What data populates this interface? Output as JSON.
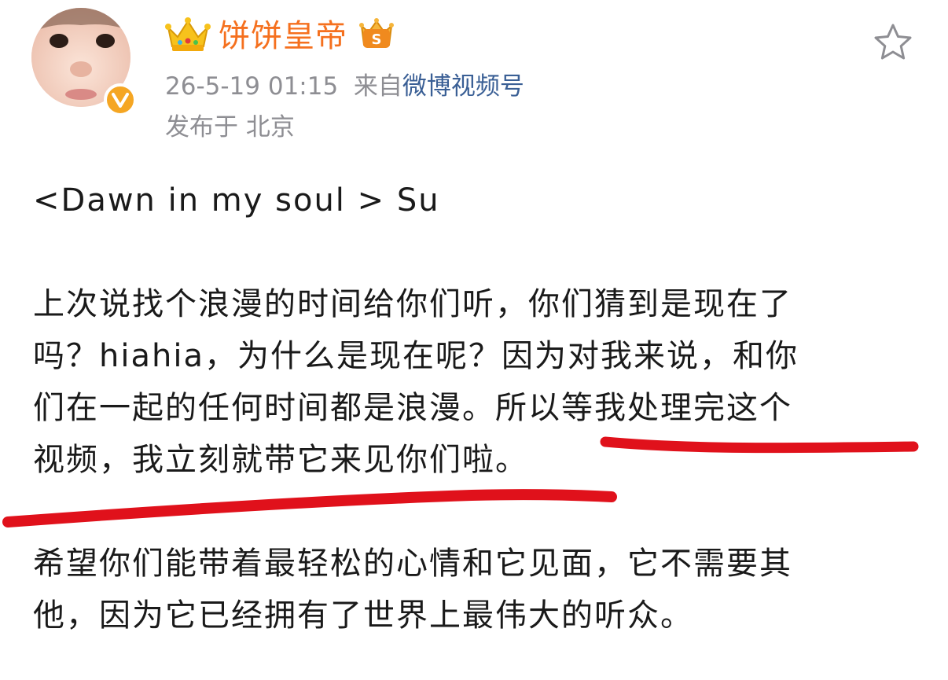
{
  "user": {
    "name": "饼饼皇帝",
    "crown_emoji": "👑",
    "verified": true
  },
  "meta": {
    "timestamp": "26-5-19 01:15",
    "source_prefix": "来自",
    "source": "微博视频号",
    "location": "发布于 北京"
  },
  "post": {
    "title": "<Dawn in my soul > Su",
    "para1_line1": "上次说找个浪漫的时间给你们听，你们猜到是现在了",
    "para1_line2": "吗？hiahia，为什么是现在呢？因为对我来说，和你",
    "para1_line3_a": "们在一起的任何时间都是浪漫。所",
    "para1_line3_b": "以等我处理完这个",
    "para1_line4": "视频，我立刻就带它来见你们啦。",
    "para2_line1": "希望你们能带着最轻松的心情和它见面，它不需要其",
    "para2_line2": "他，因为它已经拥有了世界上最伟大的听众。"
  },
  "colors": {
    "username": "#f5701e",
    "meta": "#8e8e93",
    "link": "#3a5f95",
    "underline": "#e0111b",
    "verified_badge": "#f5a623"
  },
  "icons": {
    "favorite": "star-outline-icon",
    "verified": "verified-v-icon",
    "crown": "crown-icon",
    "member_badge": "member-badge-icon"
  }
}
